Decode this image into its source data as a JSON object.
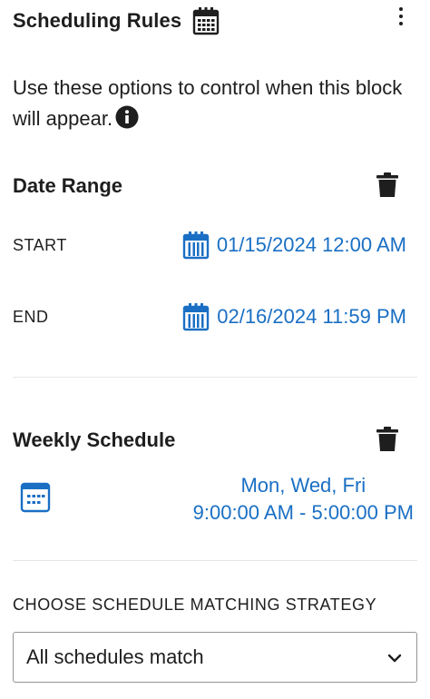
{
  "header": {
    "title": "Scheduling Rules",
    "title_icon": "calendar-icon",
    "menu_icon": "more-vertical-icon"
  },
  "description": {
    "text": "Use these options to control when this block will appear.",
    "info_icon": "info-icon"
  },
  "date_range": {
    "title": "Date Range",
    "delete_icon": "trash-icon",
    "start_label": "START",
    "start_value": "01/15/2024 12:00 AM",
    "end_label": "END",
    "end_value": "02/16/2024 11:59 PM"
  },
  "weekly_schedule": {
    "title": "Weekly Schedule",
    "delete_icon": "trash-icon",
    "icon": "calendar-icon",
    "days": "Mon, Wed, Fri",
    "time_range": "9:00:00 AM - 5:00:00 PM"
  },
  "strategy": {
    "label": "CHOOSE SCHEDULE MATCHING STRATEGY",
    "selected": "All schedules match"
  },
  "colors": {
    "accent": "#1a6fc4",
    "text": "#1e1e1e",
    "divider": "#e6e6e6",
    "border": "#949494"
  }
}
